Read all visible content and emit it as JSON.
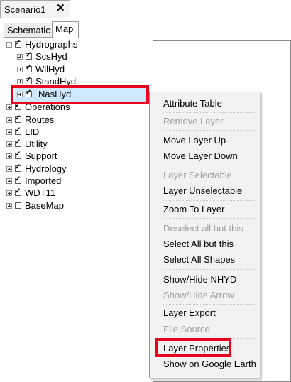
{
  "document_tab": {
    "title": "Scenario1",
    "close_glyph": "✕"
  },
  "view_tabs": [
    {
      "label": "Schematic"
    },
    {
      "label": "Map"
    }
  ],
  "layer_tree": {
    "groups": [
      {
        "label": "Hydrographs",
        "expanded": true,
        "checked": true,
        "children": [
          {
            "label": "ScsHyd",
            "checked": true
          },
          {
            "label": "WilHyd",
            "checked": true
          },
          {
            "label": "StandHyd",
            "checked": true
          },
          {
            "label": "NasHyd",
            "checked": true,
            "selected": true
          }
        ]
      },
      {
        "label": "Operations",
        "expanded": false,
        "checked": true
      },
      {
        "label": "Routes",
        "expanded": false,
        "checked": true
      },
      {
        "label": "LID",
        "expanded": false,
        "checked": true
      },
      {
        "label": "Utility",
        "expanded": false,
        "checked": true
      },
      {
        "label": "Support",
        "expanded": false,
        "checked": true
      },
      {
        "label": "Hydrology",
        "expanded": false,
        "checked": true
      },
      {
        "label": "Imported",
        "expanded": false,
        "checked": true
      },
      {
        "label": "WDT11",
        "expanded": false,
        "checked": true
      },
      {
        "label": "BaseMap",
        "expanded": false,
        "checked": false
      }
    ]
  },
  "context_menu": {
    "items": [
      {
        "label": "Attribute Table",
        "enabled": true
      },
      {
        "label": "Remove Layer",
        "enabled": false
      },
      {
        "label": "Move Layer Up",
        "enabled": true
      },
      {
        "label": "Move Layer Down",
        "enabled": true
      },
      {
        "label": "Layer Selectable",
        "enabled": false
      },
      {
        "label": "Layer Unselectable",
        "enabled": true
      },
      {
        "label": "Zoom To Layer",
        "enabled": true
      },
      {
        "label": "Deselect all but this",
        "enabled": false
      },
      {
        "label": "Select All but this",
        "enabled": true
      },
      {
        "label": "Select All Shapes",
        "enabled": true
      },
      {
        "label": "Show/Hide NHYD",
        "enabled": true
      },
      {
        "label": "Show/Hide Arrow",
        "enabled": false
      },
      {
        "label": "Layer Export",
        "enabled": true
      },
      {
        "label": "File Source",
        "enabled": false
      },
      {
        "label": "Layer Properties",
        "enabled": true,
        "highlighted": true
      },
      {
        "label": "Show on Google Earth",
        "enabled": true
      }
    ]
  },
  "annotation_color": "#e8001c",
  "selection_color": "#cde8ff"
}
